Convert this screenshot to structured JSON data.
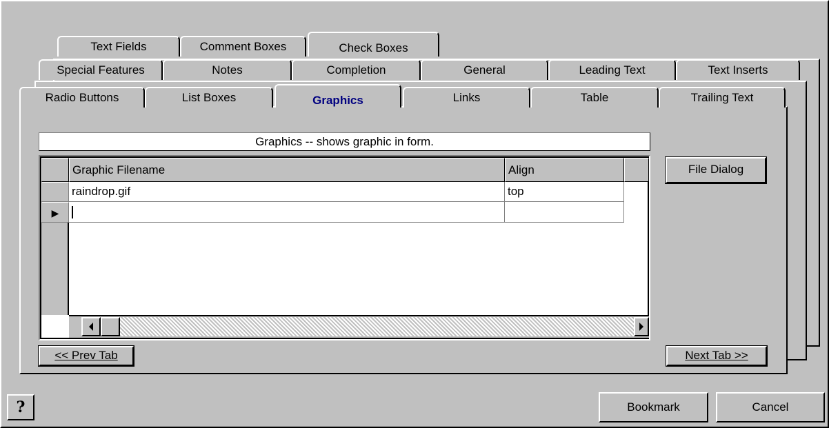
{
  "tabs": {
    "row1": [
      "Text Fields",
      "Comment Boxes",
      "Check Boxes"
    ],
    "row2": [
      "Special Features",
      "Notes",
      "Completion",
      "General",
      "Leading Text",
      "Text Inserts"
    ],
    "row3": [
      "Radio Buttons",
      "List Boxes",
      "Graphics",
      "Links",
      "Table",
      "Trailing Text"
    ],
    "active": "Graphics"
  },
  "description": "Graphics -- shows graphic in form.",
  "grid": {
    "columns": [
      "Graphic Filename",
      "Align"
    ],
    "rows": [
      {
        "filename": "raindrop.gif",
        "align": "top"
      },
      {
        "filename": "",
        "align": ""
      }
    ],
    "current_row_indicator": "▶"
  },
  "buttons": {
    "file_dialog": "File Dialog",
    "prev_tab": "<< Prev Tab",
    "next_tab": "Next Tab >>",
    "help": "?",
    "bookmark": "Bookmark",
    "cancel": "Cancel"
  },
  "colors": {
    "face": "#c0c0c0",
    "active_tab_text": "#000080"
  }
}
